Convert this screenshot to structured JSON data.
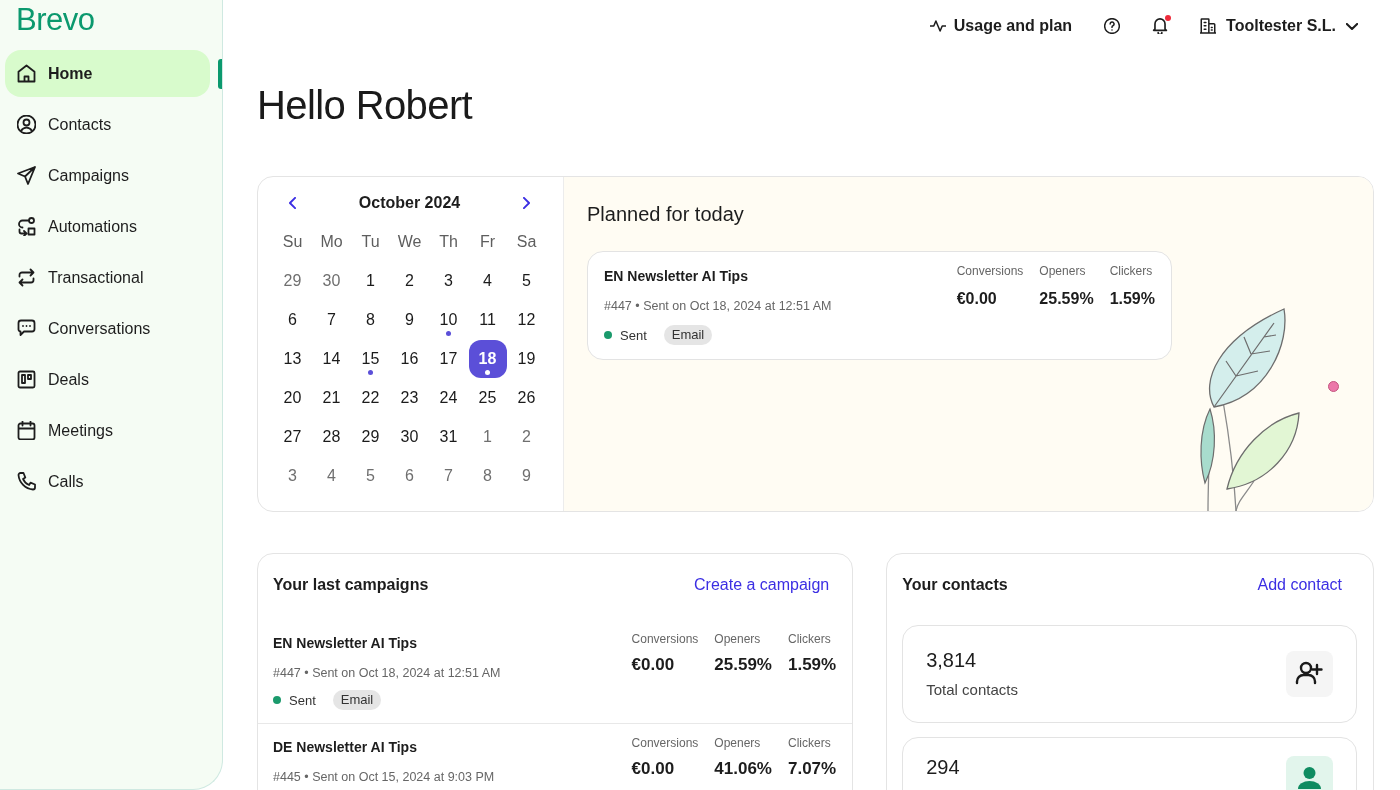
{
  "sidebar": {
    "logo": "Brevo",
    "items": [
      {
        "label": "Home",
        "selected": true
      },
      {
        "label": "Contacts",
        "selected": false
      },
      {
        "label": "Campaigns",
        "selected": false
      },
      {
        "label": "Automations",
        "selected": false
      },
      {
        "label": "Transactional",
        "selected": false
      },
      {
        "label": "Conversations",
        "selected": false
      },
      {
        "label": "Deals",
        "selected": false
      },
      {
        "label": "Meetings",
        "selected": false
      },
      {
        "label": "Calls",
        "selected": false
      }
    ]
  },
  "topbar": {
    "usage": "Usage and plan",
    "notifications": {
      "unread": true
    },
    "account": "Tooltester S.L."
  },
  "greeting": "Hello Robert",
  "calendar": {
    "month": "October 2024",
    "weekdays": [
      "Su",
      "Mo",
      "Tu",
      "We",
      "Th",
      "Fr",
      "Sa"
    ],
    "weeks": [
      [
        {
          "day": "29",
          "outside": true,
          "selected": false,
          "event": false
        },
        {
          "day": "30",
          "outside": true,
          "selected": false,
          "event": false
        },
        {
          "day": "1",
          "outside": false,
          "selected": false,
          "event": false
        },
        {
          "day": "2",
          "outside": false,
          "selected": false,
          "event": false
        },
        {
          "day": "3",
          "outside": false,
          "selected": false,
          "event": false
        },
        {
          "day": "4",
          "outside": false,
          "selected": false,
          "event": false
        },
        {
          "day": "5",
          "outside": false,
          "selected": false,
          "event": false
        }
      ],
      [
        {
          "day": "6",
          "outside": false,
          "selected": false,
          "event": false
        },
        {
          "day": "7",
          "outside": false,
          "selected": false,
          "event": false
        },
        {
          "day": "8",
          "outside": false,
          "selected": false,
          "event": false
        },
        {
          "day": "9",
          "outside": false,
          "selected": false,
          "event": false
        },
        {
          "day": "10",
          "outside": false,
          "selected": false,
          "event": true
        },
        {
          "day": "11",
          "outside": false,
          "selected": false,
          "event": false
        },
        {
          "day": "12",
          "outside": false,
          "selected": false,
          "event": false
        }
      ],
      [
        {
          "day": "13",
          "outside": false,
          "selected": false,
          "event": false
        },
        {
          "day": "14",
          "outside": false,
          "selected": false,
          "event": false
        },
        {
          "day": "15",
          "outside": false,
          "selected": false,
          "event": true
        },
        {
          "day": "16",
          "outside": false,
          "selected": false,
          "event": false
        },
        {
          "day": "17",
          "outside": false,
          "selected": false,
          "event": false
        },
        {
          "day": "18",
          "outside": false,
          "selected": true,
          "event": true
        },
        {
          "day": "19",
          "outside": false,
          "selected": false,
          "event": false
        }
      ],
      [
        {
          "day": "20",
          "outside": false,
          "selected": false,
          "event": false
        },
        {
          "day": "21",
          "outside": false,
          "selected": false,
          "event": false
        },
        {
          "day": "22",
          "outside": false,
          "selected": false,
          "event": false
        },
        {
          "day": "23",
          "outside": false,
          "selected": false,
          "event": false
        },
        {
          "day": "24",
          "outside": false,
          "selected": false,
          "event": false
        },
        {
          "day": "25",
          "outside": false,
          "selected": false,
          "event": false
        },
        {
          "day": "26",
          "outside": false,
          "selected": false,
          "event": false
        }
      ],
      [
        {
          "day": "27",
          "outside": false,
          "selected": false,
          "event": false
        },
        {
          "day": "28",
          "outside": false,
          "selected": false,
          "event": false
        },
        {
          "day": "29",
          "outside": false,
          "selected": false,
          "event": false
        },
        {
          "day": "30",
          "outside": false,
          "selected": false,
          "event": false
        },
        {
          "day": "31",
          "outside": false,
          "selected": false,
          "event": false
        },
        {
          "day": "1",
          "outside": true,
          "selected": false,
          "event": false
        },
        {
          "day": "2",
          "outside": true,
          "selected": false,
          "event": false
        }
      ],
      [
        {
          "day": "3",
          "outside": true,
          "selected": false,
          "event": false
        },
        {
          "day": "4",
          "outside": true,
          "selected": false,
          "event": false
        },
        {
          "day": "5",
          "outside": true,
          "selected": false,
          "event": false
        },
        {
          "day": "6",
          "outside": true,
          "selected": false,
          "event": false
        },
        {
          "day": "7",
          "outside": true,
          "selected": false,
          "event": false
        },
        {
          "day": "8",
          "outside": true,
          "selected": false,
          "event": false
        },
        {
          "day": "9",
          "outside": true,
          "selected": false,
          "event": false
        }
      ]
    ]
  },
  "planned_for_today": {
    "title": "Planned for today",
    "campaigns": [
      {
        "name": "EN Newsletter AI Tips",
        "meta": "#447 • Sent on Oct 18, 2024 at 12:51 AM",
        "status": {
          "label": "Sent",
          "color": "#1b9a6c"
        },
        "channel": "Email",
        "stats": [
          {
            "label": "Conversions",
            "value": "€0.00"
          },
          {
            "label": "Openers",
            "value": "25.59%"
          },
          {
            "label": "Clickers",
            "value": "1.59%"
          }
        ]
      }
    ]
  },
  "last_campaigns": {
    "title": "Your last campaigns",
    "action": "Create a campaign",
    "rows": [
      {
        "name": "EN Newsletter AI Tips",
        "meta": "#447 • Sent on Oct 18, 2024 at 12:51 AM",
        "status": {
          "label": "Sent",
          "color": "#1b9a6c"
        },
        "channel": "Email",
        "stats": [
          {
            "label": "Conversions",
            "value": "€0.00"
          },
          {
            "label": "Openers",
            "value": "25.59%"
          },
          {
            "label": "Clickers",
            "value": "1.59%"
          }
        ]
      },
      {
        "name": "DE Newsletter AI Tips",
        "meta": "#445 • Sent on Oct 15, 2024 at 9:03 PM",
        "stats": [
          {
            "label": "Conversions",
            "value": "€0.00"
          },
          {
            "label": "Openers",
            "value": "41.06%"
          },
          {
            "label": "Clickers",
            "value": "7.07%"
          }
        ]
      }
    ]
  },
  "contacts": {
    "title": "Your contacts",
    "action": "Add contact",
    "stats": [
      {
        "value": "3,814",
        "label": "Total contacts",
        "kind": "plain"
      },
      {
        "value": "294",
        "kind": "accent"
      }
    ]
  }
}
